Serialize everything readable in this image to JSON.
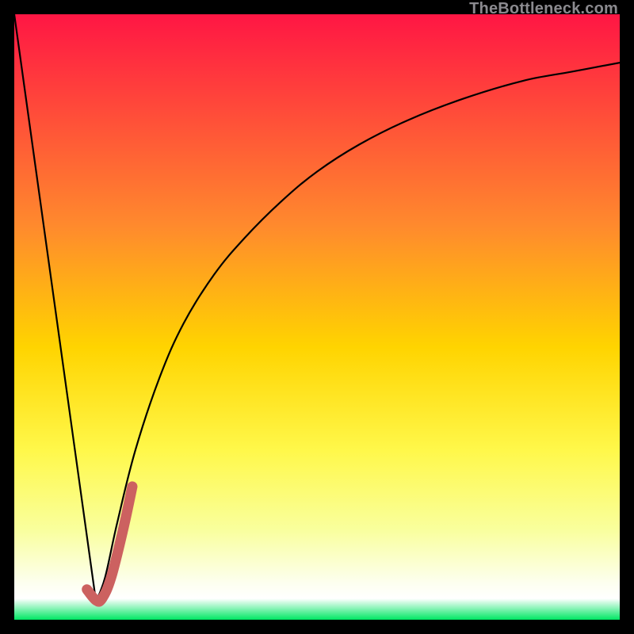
{
  "watermark": {
    "text": "TheBottleneck.com"
  },
  "palette": {
    "frame": "#000000",
    "grad_top": "#ff1644",
    "grad_mid_upper": "#ff8a2d",
    "grad_mid": "#ffd400",
    "grad_mid_lower": "#fff84a",
    "grad_lower": "#f9ff9c",
    "grad_cream": "#fdfff0",
    "grad_green": "#00e763",
    "curve": "#000000",
    "marker": "#cc6160"
  },
  "chart_data": {
    "type": "line",
    "title": "",
    "xlabel": "",
    "ylabel": "",
    "xlim": [
      0,
      100
    ],
    "ylim": [
      0,
      100
    ],
    "series": [
      {
        "name": "bottleneck-curve-left",
        "x": [
          0,
          13.5
        ],
        "values": [
          100,
          3
        ]
      },
      {
        "name": "bottleneck-curve-right",
        "x": [
          13.5,
          15,
          17,
          20,
          24,
          28,
          33,
          38,
          44,
          50,
          57,
          65,
          74,
          84,
          92,
          100
        ],
        "values": [
          3,
          7,
          16,
          28,
          40,
          49,
          57,
          63,
          69,
          74,
          78.5,
          82.5,
          86,
          89,
          90.5,
          92
        ]
      },
      {
        "name": "marker-j",
        "x": [
          12,
          13.5,
          14.5,
          16,
          18,
          19.5
        ],
        "values": [
          5,
          3.2,
          3.5,
          7,
          15,
          22
        ]
      }
    ],
    "gradient_stops": [
      {
        "pos": 0.0,
        "color": "#ff1644"
      },
      {
        "pos": 0.35,
        "color": "#ff8a2d"
      },
      {
        "pos": 0.55,
        "color": "#ffd400"
      },
      {
        "pos": 0.72,
        "color": "#fff84a"
      },
      {
        "pos": 0.85,
        "color": "#f9ff9c"
      },
      {
        "pos": 0.94,
        "color": "#fdfff0"
      },
      {
        "pos": 0.965,
        "color": "#ffffff"
      },
      {
        "pos": 1.0,
        "color": "#00e763"
      }
    ]
  }
}
